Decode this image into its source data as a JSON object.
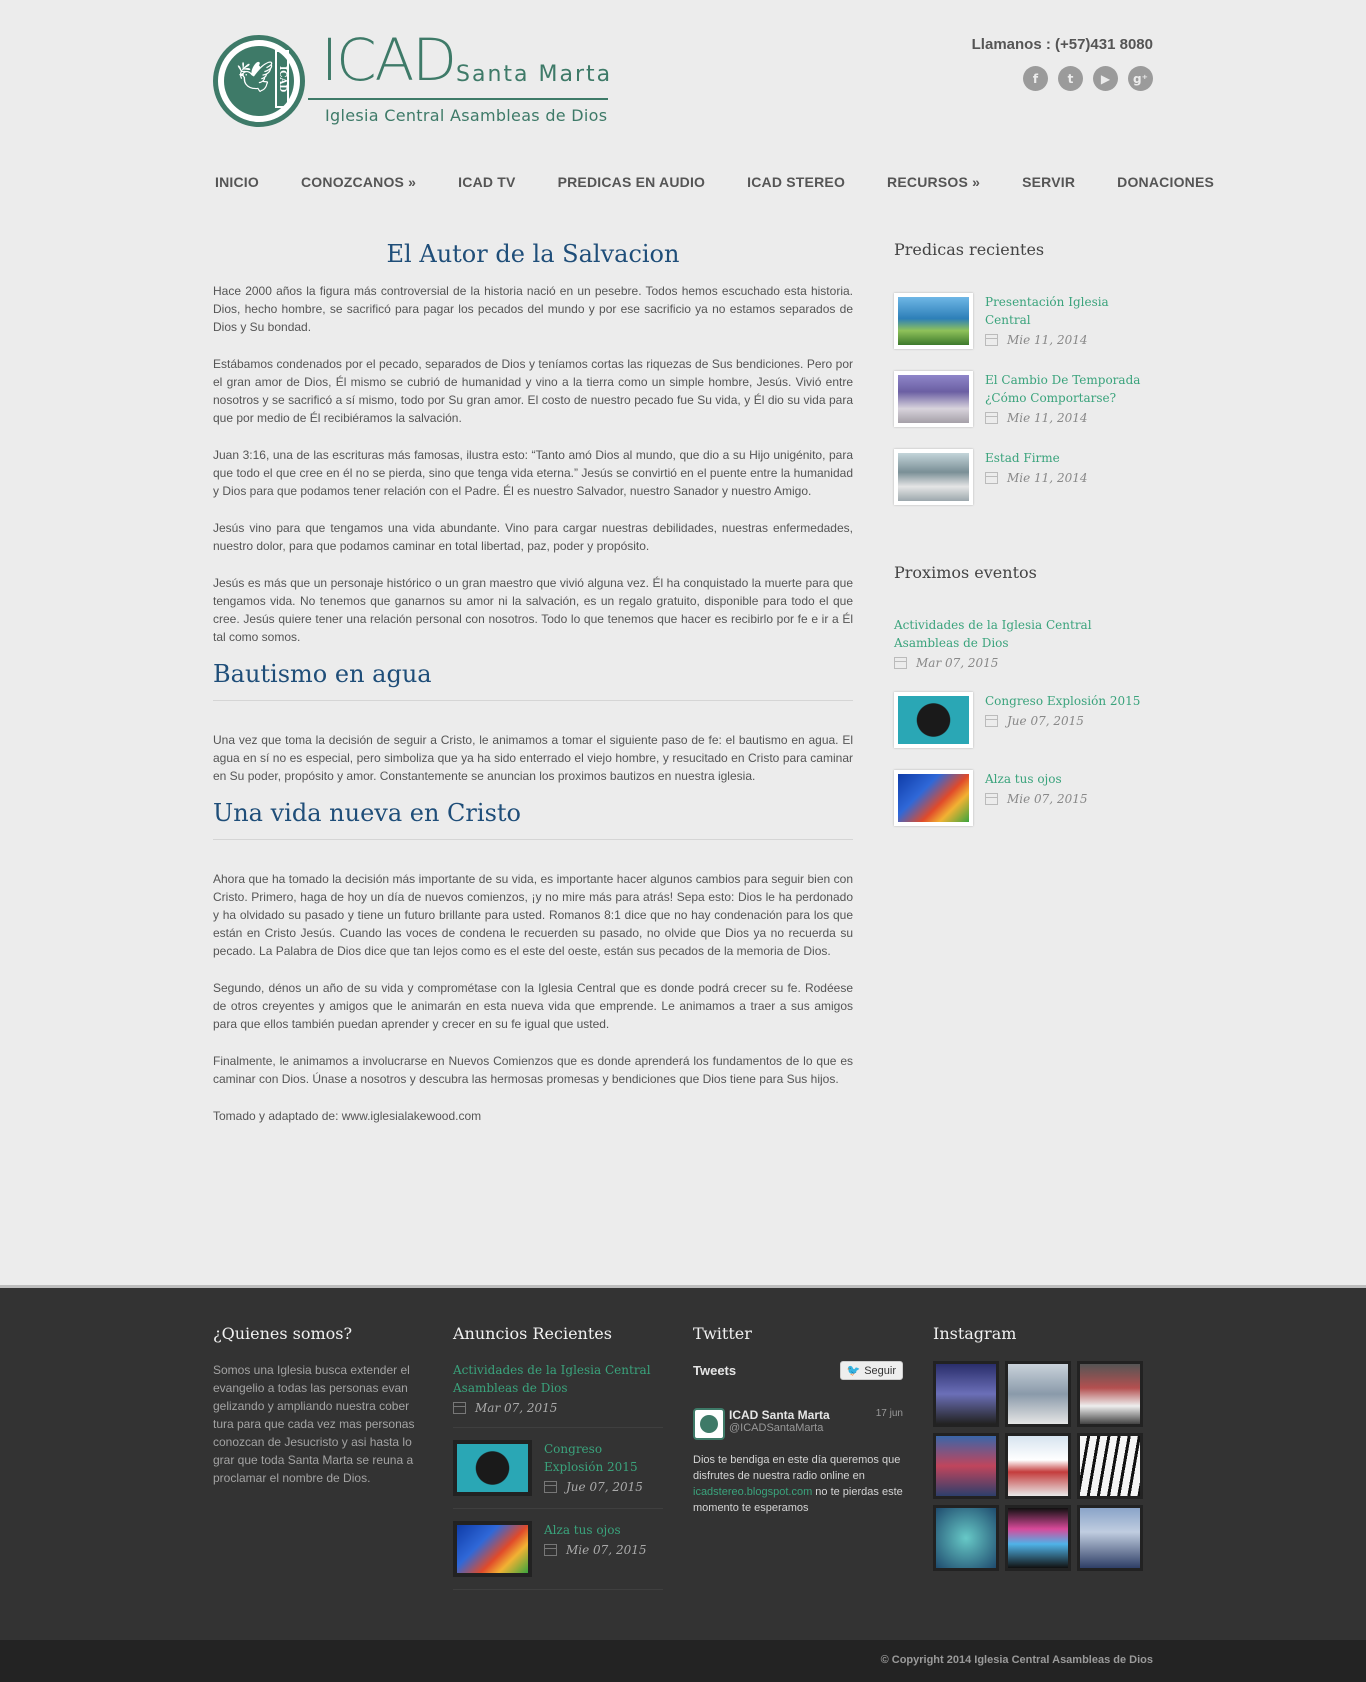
{
  "header": {
    "logo_main": "ICAD",
    "logo_city": "Santa Marta",
    "logo_sub": "Iglesia Central Asambleas de Dios",
    "logo_vertical": "ICAD",
    "phone": "Llamanos : (+57)431 8080",
    "social": [
      {
        "icon": "facebook-icon",
        "glyph": "f"
      },
      {
        "icon": "twitter-icon",
        "glyph": "t"
      },
      {
        "icon": "youtube-icon",
        "glyph": "▶"
      },
      {
        "icon": "google-plus-icon",
        "glyph": "g⁺"
      }
    ]
  },
  "nav": [
    {
      "label": "INICIO"
    },
    {
      "label": "CONOZCANOS »"
    },
    {
      "label": "ICAD TV"
    },
    {
      "label": "PREDICAS EN AUDIO"
    },
    {
      "label": "ICAD STEREO"
    },
    {
      "label": "RECURSOS »"
    },
    {
      "label": "SERVIR"
    },
    {
      "label": "DONACIONES"
    }
  ],
  "main": {
    "title": "El Autor de la Salvacion",
    "p1": "Hace 2000 años la figura más controversial de la historia nació en un pesebre. Todos hemos escuchado esta historia. Dios, hecho hombre, se sacrificó para pagar los pecados del mundo y por ese sacrificio ya no estamos separados de Dios y Su bondad.",
    "p2": "Estábamos condenados por el pecado, separados de Dios y teníamos cortas las riquezas de Sus bendiciones. Pero por el gran amor de Dios, Él mismo se cubrió de humanidad y vino a la tierra como un simple hombre, Jesús. Vivió entre nosotros y se sacrificó a sí mismo, todo por Su gran amor. El costo de nuestro pecado fue Su vida, y Él dio su vida para que por medio de Él recibiéramos la salvación.",
    "p3": "Juan 3:16, una de las escrituras más famosas, ilustra esto: “Tanto amó Dios al mundo, que dio a su Hijo unigénito, para que todo el que cree en él no se pierda, sino que tenga vida eterna.” Jesús se convirtió en el puente entre la humanidad y Dios para que podamos tener relación con el Padre. Él es nuestro Salvador, nuestro Sanador y nuestro Amigo.",
    "p4": "Jesús vino para que tengamos una vida abundante. Vino para cargar nuestras debilidades, nuestras enfermedades, nuestro dolor, para que podamos caminar en total libertad, paz, poder y propósito.",
    "p5": "Jesús es más que un personaje histórico o un gran maestro que vivió alguna vez. Él ha conquistado la muerte para que tengamos vida. No tenemos que ganarnos su amor ni la salvación, es un regalo gratuito, disponible para todo el que cree. Jesús quiere tener una relación personal con nosotros. Todo lo que tenemos que hacer es recibirlo por fe e ir a Él tal como somos.",
    "h2a": "Bautismo en agua",
    "p6": "Una vez que toma la decisión de seguir a Cristo, le animamos a tomar el siguiente paso de fe: el bautismo en agua. El agua en sí no es especial, pero simboliza que ya ha sido enterrado el viejo hombre, y resucitado en Cristo para caminar en Su poder, propósito y amor. Constantemente se anuncian los proximos bautizos en nuestra iglesia.",
    "h2b": "Una vida nueva en Cristo",
    "p7": "Ahora que ha tomado la decisión más importante de su vida, es importante hacer algunos cambios para seguir bien con Cristo. Primero, haga de hoy un día de nuevos comienzos, ¡y no mire más para atrás! Sepa esto: Dios le ha perdonado y ha olvidado su pasado y tiene un futuro brillante para usted. Romanos 8:1 dice que no hay condenación para los que están en Cristo Jesús. Cuando las voces de condena le recuerden su pasado, no olvide que Dios ya no recuerda su pecado. La Palabra de Dios dice que tan lejos como es el este del oeste, están sus pecados de la memoria de Dios.",
    "p8": "Segundo, dénos un año de su vida y comprométase con la Iglesia Central que es donde podrá crecer su fe. Rodéese de otros creyentes y amigos que le animarán en esta nueva vida que emprende. Le animamos a traer a sus amigos para que ellos también puedan aprender y crecer en su fe igual que usted.",
    "p9": "Finalmente, le animamos a involucrarse en Nuevos Comienzos que es donde aprenderá los fundamentos de lo que es caminar con Dios. Únase a nosotros y descubra las hermosas promesas y bendiciones que Dios tiene para Sus hijos.",
    "p10": "Tomado y adaptado de: www.iglesialakewood.com"
  },
  "sidebar": {
    "recent_title": "Predicas recientes",
    "recent": [
      {
        "title": "Presentación Iglesia Central",
        "date": "Mie 11, 2014"
      },
      {
        "title": "El Cambio De Temporada ¿Cómo Comportarse?",
        "date": "Mie 11, 2014"
      },
      {
        "title": "Estad Firme",
        "date": "Mie 11, 2014"
      }
    ],
    "events_title": "Proximos eventos",
    "events": [
      {
        "title": "Actividades de la Iglesia Central Asambleas de Dios",
        "date": "Mar 07, 2015"
      },
      {
        "title": "Congreso Explosión 2015",
        "date": "Jue 07, 2015"
      },
      {
        "title": "Alza tus ojos",
        "date": "Mie 07, 2015"
      }
    ]
  },
  "footer": {
    "about_title": "¿Quienes somos?",
    "about_text": "Somos una Iglesia busca extender el evangelio a todas las personas evan gelizando y ampliando nuestra cober tura para que cada vez mas personas conozcan de Jesucristo y asi hasta lo grar que toda Santa Marta se reuna a proclamar el nombre de Dios.",
    "ann_title": "Anuncios Recientes",
    "announcements": [
      {
        "title": "Actividades de la Iglesia Central Asambleas de Dios",
        "date": "Mar 07, 2015"
      },
      {
        "title": "Congreso Explosión 2015",
        "date": "Jue 07, 2015"
      },
      {
        "title": "Alza tus ojos",
        "date": "Mie 07, 2015"
      }
    ],
    "twitter_title": "Twitter",
    "tweets_label": "Tweets",
    "follow_label": "Seguir",
    "tweet": {
      "name": "ICAD Santa Marta",
      "handle": "@ICADSantaMarta",
      "date": "17 jun",
      "text_before": "Dios te bendiga en este día queremos que disfrutes de nuestra radio online en ",
      "link": "icadstereo.blogspot.com",
      "text_after": " no te pierdas este momento te esperamos"
    },
    "instagram_title": "Instagram",
    "copyright": "© Copyright 2014 Iglesia Central Asambleas de Dios"
  }
}
